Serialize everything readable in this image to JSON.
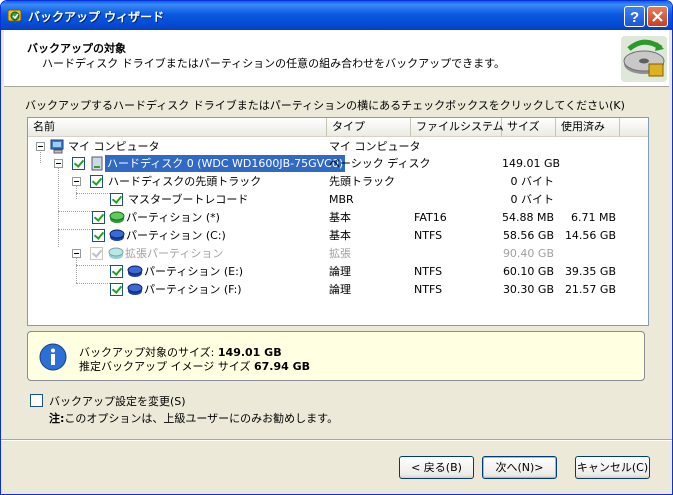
{
  "window": {
    "title": "バックアップ ウィザード"
  },
  "header": {
    "title": "バックアップの対象",
    "subtitle": "ハードディスク ドライブまたはパーティションの任意の組み合わせをバックアップできます。"
  },
  "instruction": "バックアップするハードディスク ドライブまたはパーティションの横にあるチェックボックスをクリックしてください(K)",
  "tree": {
    "columns": {
      "name": "名前",
      "type": "タイプ",
      "fs": "ファイルシステム",
      "size": "サイズ",
      "used": "使用済み"
    },
    "rows": [
      {
        "name": "マイ コンピュータ",
        "type": "マイ コンピュータ",
        "fs": "",
        "size": "",
        "used": ""
      },
      {
        "name": "ハードディスク 0 (WDC WD1600JB-75GVC0)",
        "type": "ベーシック ディスク",
        "fs": "",
        "size": "149.01 GB",
        "used": "",
        "checked": true,
        "selected": true
      },
      {
        "name": "ハードディスクの先頭トラック",
        "type": "先頭トラック",
        "fs": "",
        "size": "0 バイト",
        "used": "",
        "checked": true
      },
      {
        "name": "マスターブートレコード",
        "type": "MBR",
        "fs": "",
        "size": "0 バイト",
        "used": "",
        "checked": true
      },
      {
        "name": "パーティション (*)",
        "type": "基本",
        "fs": "FAT16",
        "size": "54.88 MB",
        "used": "6.71 MB",
        "checked": true
      },
      {
        "name": "パーティション (C:)",
        "type": "基本",
        "fs": "NTFS",
        "size": "58.56 GB",
        "used": "14.56 GB",
        "checked": true
      },
      {
        "name": "拡張パーティション",
        "type": "拡張",
        "fs": "",
        "size": "90.40 GB",
        "used": "",
        "checked": true,
        "disabled": true
      },
      {
        "name": "パーティション (E:)",
        "type": "論理",
        "fs": "NTFS",
        "size": "60.10 GB",
        "used": "39.35 GB",
        "checked": true
      },
      {
        "name": "パーティション (F:)",
        "type": "論理",
        "fs": "NTFS",
        "size": "30.30 GB",
        "used": "21.57 GB",
        "checked": true
      }
    ]
  },
  "info": {
    "size_label": "バックアップ対象のサイズ:",
    "size_value": "149.01 GB",
    "image_label": "推定バックアップ イメージ サイズ",
    "image_value": "67.94 GB"
  },
  "options": {
    "change_label": "バックアップ設定を変更(S)",
    "note_bold": "注:",
    "note_text": "このオプションは、上級ユーザーにのみお勧めします。"
  },
  "buttons": {
    "back": "< 戻る(B)",
    "next": "次へ(N)>",
    "cancel": "キャンセル(C)"
  },
  "colors": {
    "title_bar": "#0a5fe6",
    "selection": "#316ac5",
    "info_bg": "#ffffe1",
    "window_bg": "#ece9d8"
  },
  "icons": [
    "app-icon",
    "help-icon",
    "close-icon",
    "wizard-banner-icon",
    "computer-icon",
    "harddisk-icon",
    "partition-icon",
    "info-icon"
  ]
}
